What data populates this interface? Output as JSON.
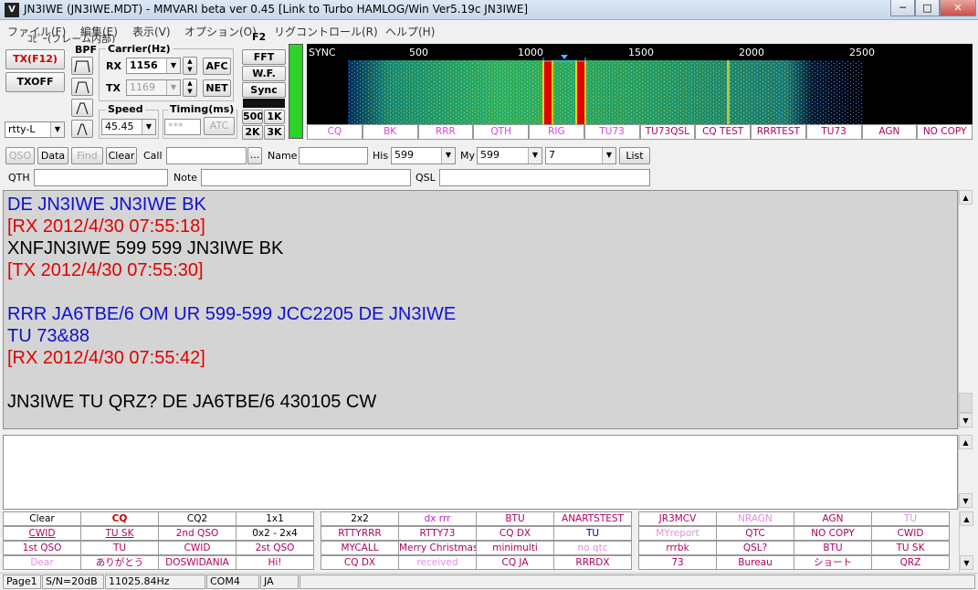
{
  "window": {
    "title": "JN3IWE (JN3IWE.MDT) - MMVARI beta ver 0.45 [Link to Turbo HAMLOG/Win Ver5.19c JN3IWE]",
    "icon_label": "V",
    "min_label": "─",
    "max_label": "□",
    "close_label": "✕"
  },
  "menu": [
    "ファイル(F)",
    "編集(E)",
    "表示(V)",
    "オプション(O)",
    "リグコントロール(R)",
    "ヘルプ(H)"
  ],
  "copy_frame_label": "ｺﾋﾟｰ(フレーム内部)",
  "left": {
    "tx_button": "TX(F12)",
    "txoff_button": "TXOFF",
    "bpf_label": "BPF",
    "mode_value": "rtty-L"
  },
  "carrier": {
    "group_label": "Carrier(Hz)",
    "rx_label": "RX",
    "rx_value": "1156",
    "tx_label": "TX",
    "tx_value": "1169",
    "afc_label": "AFC",
    "net_label": "NET"
  },
  "speed": {
    "label": "Speed",
    "value": "45.45"
  },
  "timing": {
    "label": "Timing(ms)",
    "value": "***",
    "atc_label": "ATC"
  },
  "display_controls": {
    "f2_label": "F2",
    "fft_label": "FFT",
    "wf_label": "W.F.",
    "sync_label": "Sync",
    "bw_buttons": [
      "500",
      "1K",
      "2K",
      "3K"
    ]
  },
  "waterfall": {
    "sync_label": "SYNC",
    "scale": [
      "500",
      "1000",
      "1500",
      "2000",
      "2500"
    ],
    "quick_macros": [
      {
        "label": "CQ",
        "color": "#e040e0"
      },
      {
        "label": "BK",
        "color": "#e040e0"
      },
      {
        "label": "RRR",
        "color": "#e040e0"
      },
      {
        "label": "QTH",
        "color": "#e040e0"
      },
      {
        "label": "RIG",
        "color": "#e040e0"
      },
      {
        "label": "TU73",
        "color": "#e040e0"
      },
      {
        "label": "TU73QSL",
        "color": "#b00060"
      },
      {
        "label": "CQ TEST",
        "color": "#b00060"
      },
      {
        "label": "RRRTEST",
        "color": "#b00060"
      },
      {
        "label": "TU73",
        "color": "#b00060"
      },
      {
        "label": "AGN",
        "color": "#b00060"
      },
      {
        "label": "NO COPY",
        "color": "#b00060"
      }
    ]
  },
  "log_row1": {
    "qso": "QSO",
    "data": "Data",
    "find": "Find",
    "clear": "Clear",
    "call_label": "Call",
    "call_value": "",
    "dots": "...",
    "name_label": "Name",
    "name_value": "",
    "his_label": "His",
    "his_value": "599",
    "my_label": "My",
    "my_value": "599",
    "band_value": "7",
    "list_label": "List"
  },
  "log_row2": {
    "qth_label": "QTH",
    "note_label": "Note",
    "qsl_label": "QSL"
  },
  "rx_text": [
    {
      "text": "DE JN3IWE JN3IWE BK",
      "color": "#1010d0"
    },
    {
      "text": "[RX 2012/4/30 07:55:18]",
      "color": "#e00000"
    },
    {
      "text": "XNFJN3IWE 599 599 JN3IWE BK",
      "color": "#000000"
    },
    {
      "text": "[TX 2012/4/30 07:55:30]",
      "color": "#e00000"
    },
    {
      "text": "",
      "color": "#000000"
    },
    {
      "text": "RRR JA6TBE/6  OM UR 599-599 JCC2205 DE JN3IWE",
      "color": "#1010d0"
    },
    {
      "text": "TU 73&88",
      "color": "#1010d0"
    },
    {
      "text": "[RX 2012/4/30 07:55:42]",
      "color": "#e00000"
    },
    {
      "text": "",
      "color": "#000000"
    },
    {
      "text": "JN3IWE TU QRZ? DE JA6TBE/6 430105 CW",
      "color": "#000000"
    }
  ],
  "macros": [
    [
      {
        "label": "Clear",
        "color": "#000000"
      },
      {
        "label": "CQ",
        "color": "#d00000",
        "bold": true
      },
      {
        "label": "CQ2",
        "color": "#000000"
      },
      {
        "label": "1x1",
        "color": "#000000"
      },
      {
        "label": "2x2",
        "color": "#000000"
      },
      {
        "label": "dx rrr",
        "color": "#c020c0"
      },
      {
        "label": "BTU",
        "color": "#b00060"
      },
      {
        "label": "ANARTSTEST",
        "color": "#b00060"
      },
      {
        "label": "JR3MCV",
        "color": "#b00060"
      },
      {
        "label": "NRAGN",
        "color": "#e090e0"
      },
      {
        "label": "AGN",
        "color": "#b00060"
      },
      {
        "label": "TU",
        "color": "#e090e0"
      }
    ],
    [
      {
        "label": "CWID",
        "color": "#b00060",
        "underline": true
      },
      {
        "label": "TU SK",
        "color": "#b00060",
        "underline": true
      },
      {
        "label": "2nd QSO",
        "color": "#b00060"
      },
      {
        "label": "0x2 - 2x4",
        "color": "#000000"
      },
      {
        "label": "RTTYRRR",
        "color": "#b00060"
      },
      {
        "label": "RTTY73",
        "color": "#b00060"
      },
      {
        "label": "CQ DX",
        "color": "#b00060"
      },
      {
        "label": "TU",
        "color": "#000080"
      },
      {
        "label": "MYreport",
        "color": "#e090e0"
      },
      {
        "label": "QTC",
        "color": "#b00060"
      },
      {
        "label": "NO COPY",
        "color": "#b00060"
      },
      {
        "label": "CWID",
        "color": "#b00060"
      }
    ],
    [
      {
        "label": "1st QSO",
        "color": "#b00060"
      },
      {
        "label": "TU",
        "color": "#b00060"
      },
      {
        "label": "CWID",
        "color": "#b00060"
      },
      {
        "label": "2st QSO",
        "color": "#b00060"
      },
      {
        "label": "MYCALL",
        "color": "#b00060"
      },
      {
        "label": "Merry Christmas",
        "color": "#b00060"
      },
      {
        "label": "minimulti",
        "color": "#b00060"
      },
      {
        "label": "no qtc",
        "color": "#e090e0"
      },
      {
        "label": "rrrbk",
        "color": "#b00060"
      },
      {
        "label": "QSL?",
        "color": "#b00060"
      },
      {
        "label": "BTU",
        "color": "#b00060"
      },
      {
        "label": "TU SK",
        "color": "#b00060"
      }
    ],
    [
      {
        "label": "Dear",
        "color": "#e090e0"
      },
      {
        "label": "ありがとう",
        "color": "#b00060"
      },
      {
        "label": "DOSWIDANIA",
        "color": "#b00060"
      },
      {
        "label": "Hi!",
        "color": "#b00060"
      },
      {
        "label": "CQ DX",
        "color": "#b00060"
      },
      {
        "label": "received",
        "color": "#e090e0"
      },
      {
        "label": "CQ JA",
        "color": "#b00060"
      },
      {
        "label": "RRRDX",
        "color": "#b00060"
      },
      {
        "label": "73",
        "color": "#b00060"
      },
      {
        "label": "Bureau",
        "color": "#b00060"
      },
      {
        "label": "ショート",
        "color": "#b00060"
      },
      {
        "label": "QRZ",
        "color": "#b00060"
      }
    ]
  ],
  "status": {
    "page": "Page1",
    "sn": "S/N=20dB",
    "clock": "11025.84Hz",
    "port": "COM4",
    "lang": "JA"
  }
}
